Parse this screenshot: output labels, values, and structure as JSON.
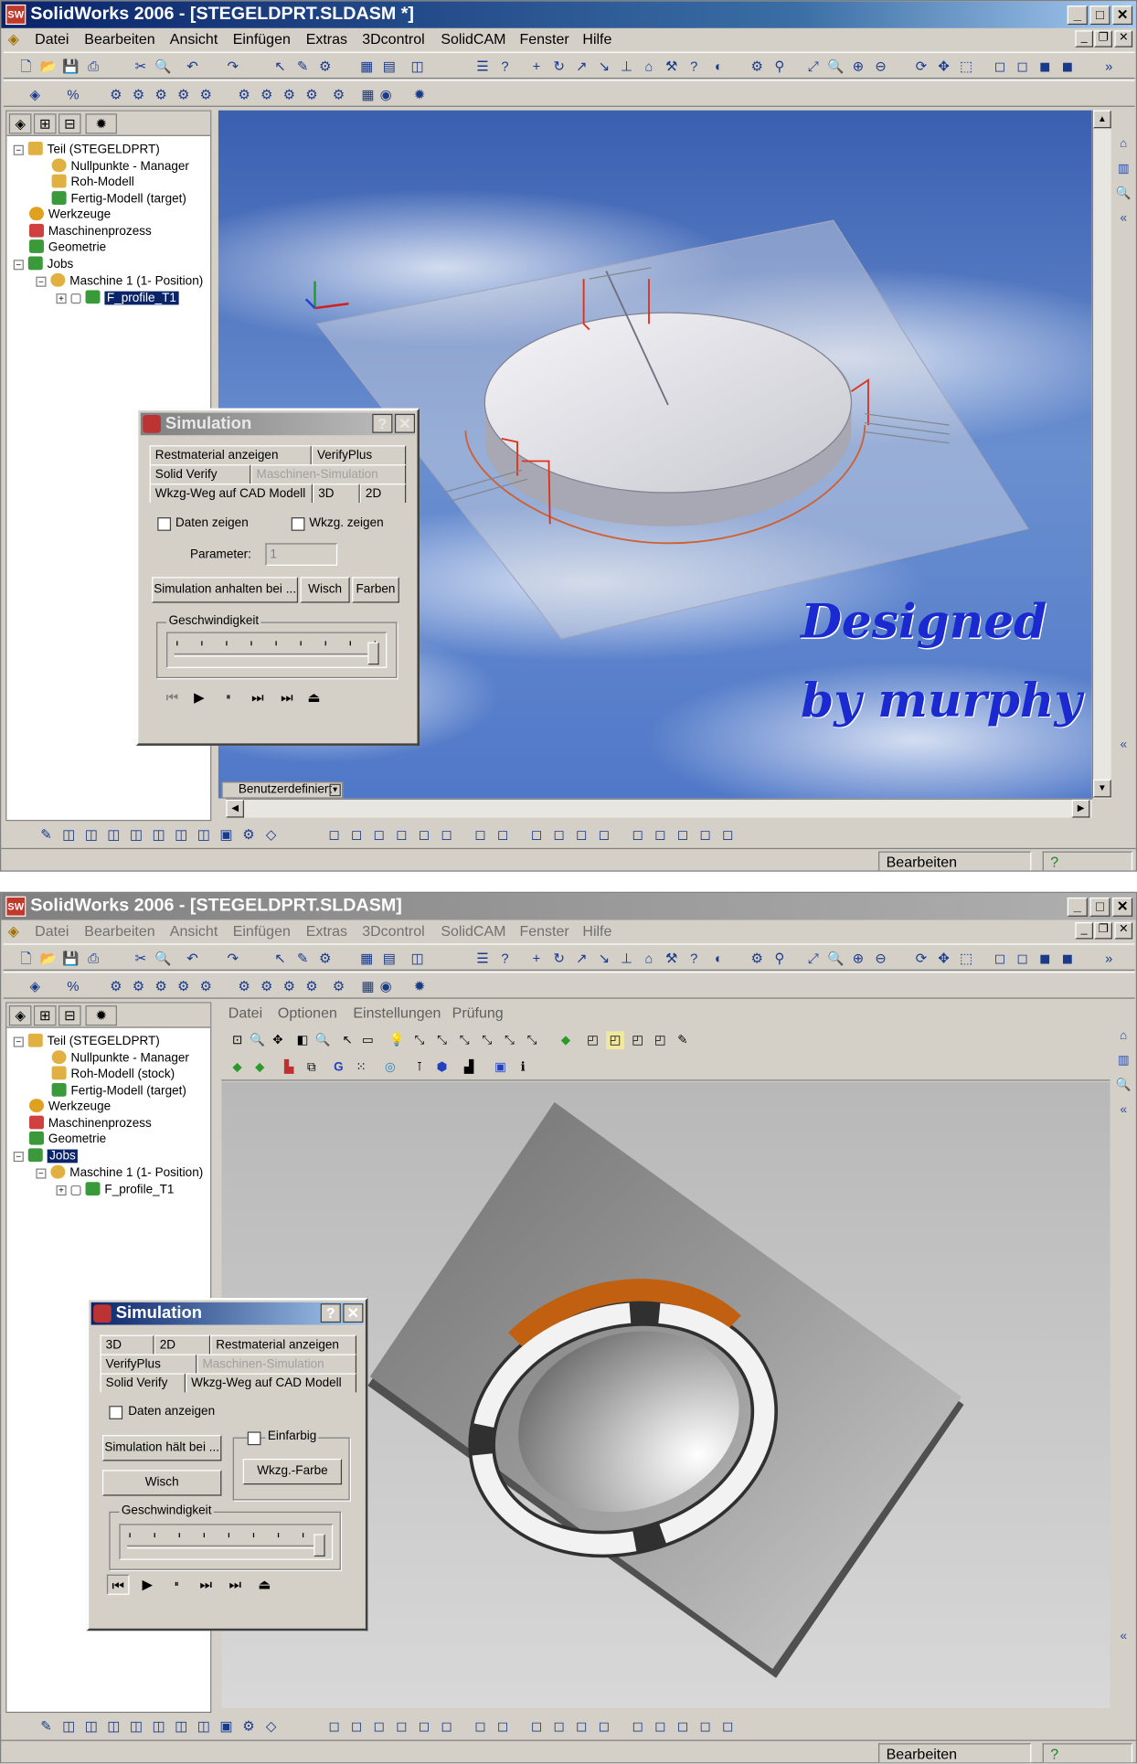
{
  "window1": {
    "title": "SolidWorks 2006 - [STEGELDPRT.SLDASM *]",
    "menu": [
      "Datei",
      "Bearbeiten",
      "Ansicht",
      "Einfügen",
      "Extras",
      "3Dcontrol",
      "SolidCAM",
      "Fenster",
      "Hilfe"
    ],
    "tree": {
      "root": "Teil (STEGELDPRT)",
      "nullpunkte": "Nullpunkte - Manager",
      "roh": "Roh-Modell",
      "fertig": "Fertig-Modell (target)",
      "werkzeuge": "Werkzeuge",
      "maschinenprozess": "Maschinenprozess",
      "geometrie": "Geometrie",
      "jobs": "Jobs",
      "maschine": "Maschine 1 (1- Position)",
      "profile": "F_profile_T1"
    },
    "watermark_line1": "Designed",
    "watermark_line2": "by murphy",
    "viewport_tab": "Benutzerdefiniert",
    "status": "Bearbeiten Baugruppe",
    "simulation": {
      "title": "Simulation",
      "tabs_row1": [
        "Restmaterial anzeigen",
        "VerifyPlus"
      ],
      "tabs_row2": [
        "Solid Verify",
        "Maschinen-Simulation"
      ],
      "tabs_row3": [
        "Wkzg-Weg auf CAD Modell",
        "3D",
        "2D"
      ],
      "show_data": "Daten zeigen",
      "show_tool": "Wkzg. zeigen",
      "parameter_label": "Parameter:",
      "parameter_value": "1",
      "btn_stop": "Simulation anhalten bei ...",
      "btn_wipe": "Wisch",
      "btn_colors": "Farben",
      "speed": "Geschwindigkeit"
    }
  },
  "window2": {
    "title": "SolidWorks 2006 - [STEGELDPRT.SLDASM]",
    "menu": [
      "Datei",
      "Bearbeiten",
      "Ansicht",
      "Einfügen",
      "Extras",
      "3Dcontrol",
      "SolidCAM",
      "Fenster",
      "Hilfe"
    ],
    "tree": {
      "root": "Teil (STEGELDPRT)",
      "nullpunkte": "Nullpunkte - Manager",
      "roh": "Roh-Modell (stock)",
      "fertig": "Fertig-Modell (target)",
      "werkzeuge": "Werkzeuge",
      "maschinenprozess": "Maschinenprozess",
      "geometrie": "Geometrie",
      "jobs": "Jobs",
      "maschine": "Maschine 1 (1- Position)",
      "profile": "F_profile_T1"
    },
    "verify_menu": [
      "Datei",
      "Optionen",
      "Einstellungen",
      "Prüfung"
    ],
    "status": "Bearbeiten Baugruppe",
    "simulation": {
      "title": "Simulation",
      "tabs_row1": [
        "3D",
        "2D",
        "Restmaterial anzeigen"
      ],
      "tabs_row2": [
        "VerifyPlus",
        "Maschinen-Simulation"
      ],
      "tabs_row3": [
        "Solid Verify",
        "Wkzg-Weg auf CAD Modell"
      ],
      "show_data": "Daten anzeigen",
      "btn_stop": "Simulation hält bei ...",
      "btn_wipe": "Wisch",
      "single_color": "Einfarbig",
      "btn_tool_color": "Wkzg.-Farbe",
      "speed": "Geschwindigkeit"
    }
  },
  "colors": {
    "title_active": "#0a246a",
    "selection": "#0a246a",
    "watermark": "#1a2ad0",
    "toolpath": "#e0301a"
  }
}
